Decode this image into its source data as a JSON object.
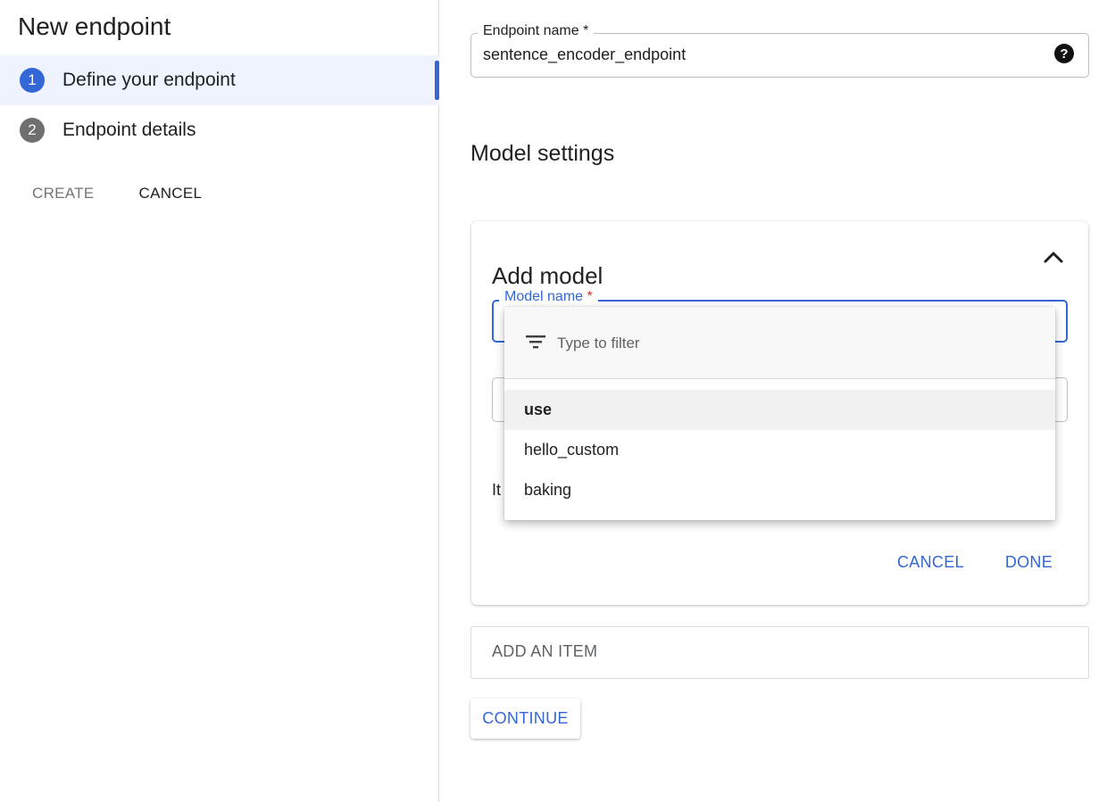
{
  "page_title": "New endpoint",
  "steps": [
    {
      "number": "1",
      "label": "Define your endpoint",
      "active": true
    },
    {
      "number": "2",
      "label": "Endpoint details",
      "active": false
    }
  ],
  "left_actions": {
    "create_label": "CREATE",
    "cancel_label": "CANCEL"
  },
  "endpoint_field": {
    "label": "Endpoint name *",
    "value": "sentence_encoder_endpoint"
  },
  "model_settings": {
    "title": "Model settings",
    "card": {
      "title": "Add model",
      "model_name_label": "Model name",
      "required_marker": "*",
      "partial_text": "It",
      "cancel_label": "CANCEL",
      "done_label": "DONE"
    }
  },
  "dropdown": {
    "filter_placeholder": "Type to filter",
    "options": [
      "use",
      "hello_custom",
      "baking"
    ],
    "highlighted_index": 0
  },
  "add_item_label": "ADD AN ITEM",
  "continue_label": "CONTINUE",
  "colors": {
    "accent": "#3367d6",
    "required": "#d93025",
    "active_step_bg": "#eef3fd"
  }
}
